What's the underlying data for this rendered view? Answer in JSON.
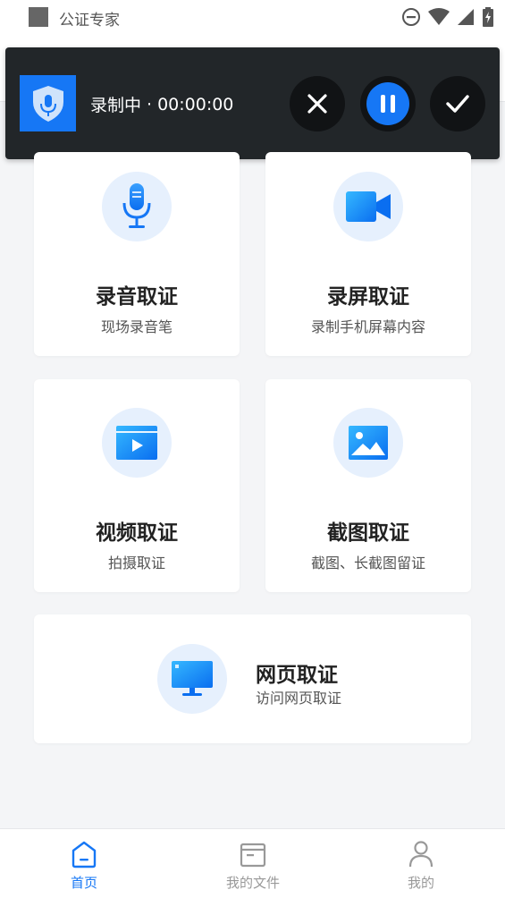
{
  "status_bar": {
    "title": "公证专家"
  },
  "recording": {
    "status": "录制中",
    "separator": "·",
    "timer": "00:00:00"
  },
  "cards": [
    {
      "title": "录音取证",
      "subtitle": "现场录音笔",
      "icon": "microphone-icon"
    },
    {
      "title": "录屏取证",
      "subtitle": "录制手机屏幕内容",
      "icon": "video-camera-icon"
    },
    {
      "title": "视频取证",
      "subtitle": "拍摄取证",
      "icon": "video-play-icon"
    },
    {
      "title": "截图取证",
      "subtitle": "截图、长截图留证",
      "icon": "image-icon"
    },
    {
      "title": "网页取证",
      "subtitle": "访问网页取证",
      "icon": "monitor-icon"
    }
  ],
  "nav": {
    "home": "首页",
    "files": "我的文件",
    "mine": "我的"
  },
  "colors": {
    "accent": "#1677f5",
    "overlay": "#222629",
    "icon_bg": "#e6f0fd"
  }
}
